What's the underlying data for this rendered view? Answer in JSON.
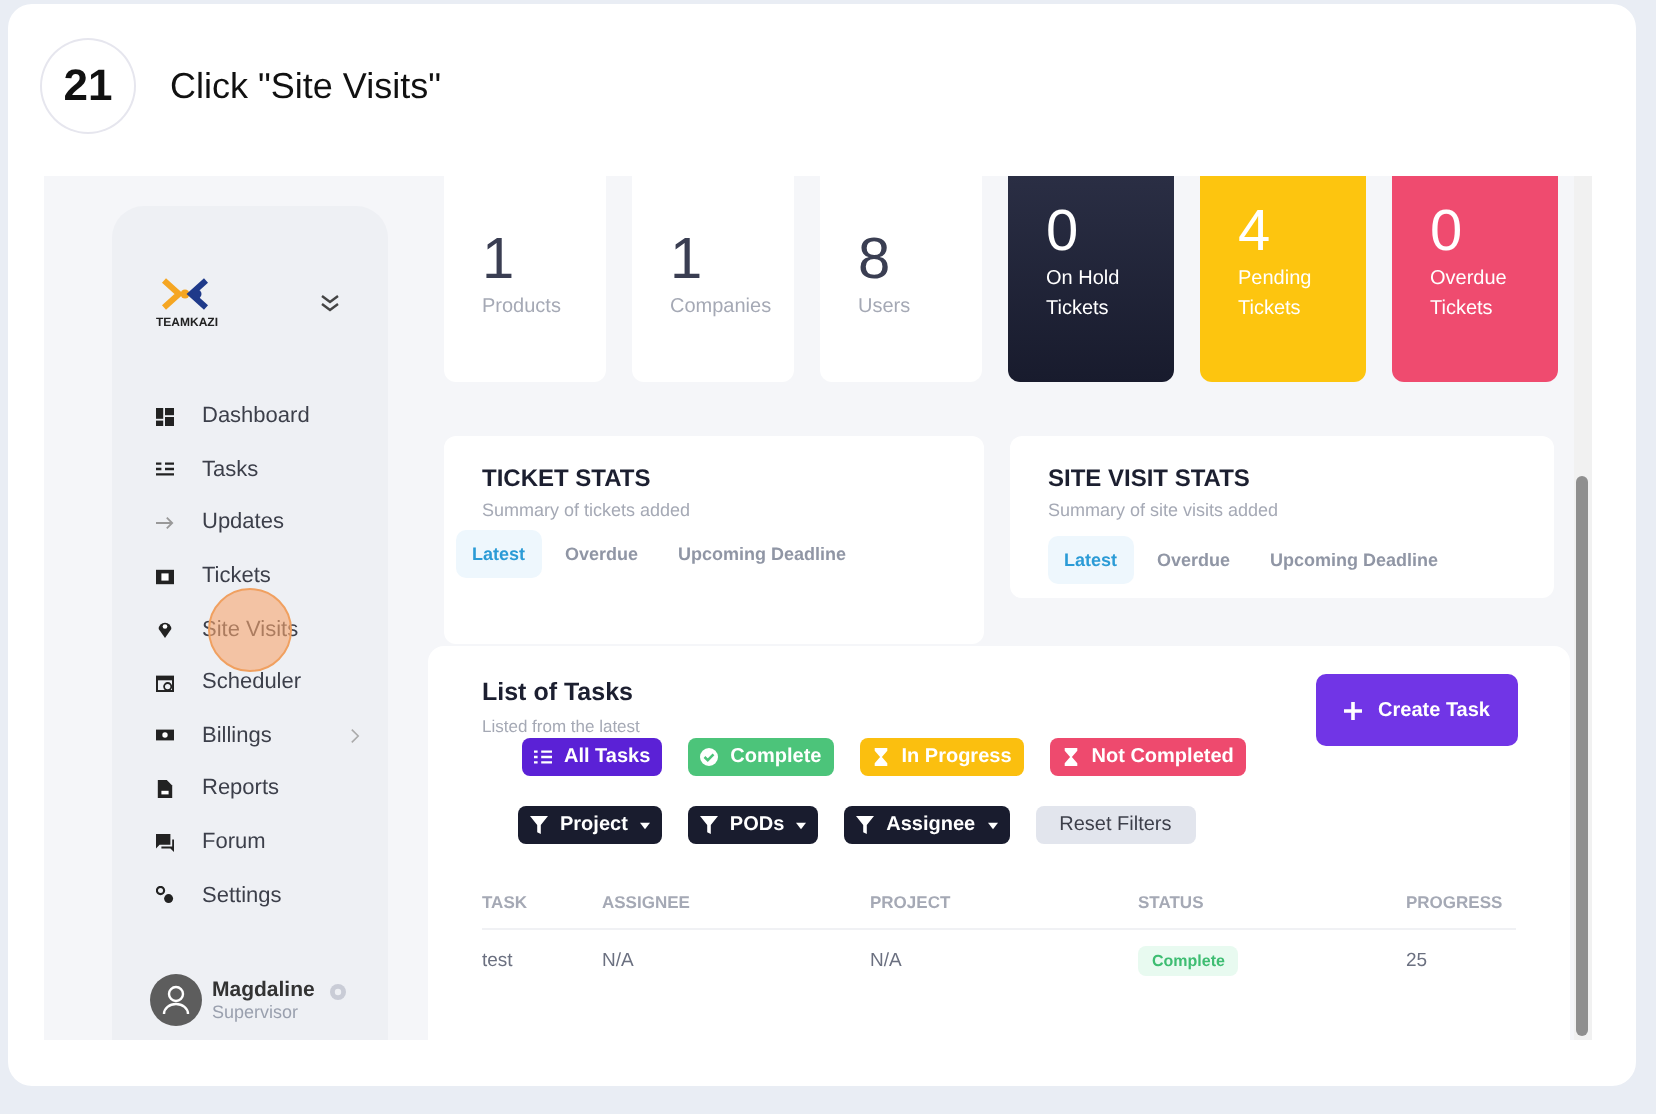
{
  "step": {
    "number": "21",
    "instruction": "Click \"Site Visits\""
  },
  "sidebar": {
    "items": [
      {
        "label": "Dashboard",
        "clicked": false,
        "submenu": false
      },
      {
        "label": "Tasks",
        "clicked": false,
        "submenu": false
      },
      {
        "label": "Updates",
        "clicked": false,
        "submenu": false
      },
      {
        "label": "Tickets",
        "clicked": false,
        "submenu": false
      },
      {
        "label": "Site Visits",
        "clicked": true,
        "submenu": false
      },
      {
        "label": "Scheduler",
        "clicked": false,
        "submenu": false
      },
      {
        "label": "Billings",
        "clicked": false,
        "submenu": true
      },
      {
        "label": "Reports",
        "clicked": false,
        "submenu": false
      },
      {
        "label": "Forum",
        "clicked": false,
        "submenu": false
      },
      {
        "label": "Settings",
        "clicked": false,
        "submenu": false
      }
    ],
    "logo_text": "TEAMKAZI",
    "user": {
      "name": "Magdaline",
      "role": "Supervisor"
    }
  },
  "stat_cards": [
    {
      "value": "1",
      "label": "Products",
      "kind": "plain"
    },
    {
      "value": "1",
      "label": "Companies",
      "kind": "plain"
    },
    {
      "value": "8",
      "label": "Users",
      "kind": "plain"
    },
    {
      "value": "0",
      "label": "On Hold Tickets",
      "kind": "dark"
    },
    {
      "value": "4",
      "label": "Pending Tickets",
      "kind": "yellow"
    },
    {
      "value": "0",
      "label": "Overdue Tickets",
      "kind": "red"
    }
  ],
  "panels": [
    {
      "title": "TICKET STATS",
      "subtitle": "Summary of tickets added",
      "tabs": [
        {
          "label": "Latest",
          "selected": true
        },
        {
          "label": "Overdue",
          "selected": false
        },
        {
          "label": "Upcoming Deadline",
          "selected": false
        }
      ]
    },
    {
      "title": "SITE VISIT STATS",
      "subtitle": "Summary of site visits added",
      "tabs": [
        {
          "label": "Latest",
          "selected": true
        },
        {
          "label": "Overdue",
          "selected": false
        },
        {
          "label": "Upcoming Deadline",
          "selected": false
        }
      ]
    }
  ],
  "tasks": {
    "title": "List of Tasks",
    "subtitle": "Listed from the latest",
    "create_button": "Create Task",
    "status_filters": [
      {
        "label": "All Tasks",
        "color": "#5b21d6",
        "kind": "all"
      },
      {
        "label": "Complete",
        "color": "#4cc47a",
        "kind": "complete"
      },
      {
        "label": "In Progress",
        "color": "#fbbf0f",
        "kind": "pending"
      },
      {
        "label": "Not Completed",
        "color": "#ee4a6e",
        "kind": "pending"
      }
    ],
    "dropdown_filters": [
      "Project",
      "PODs",
      "Assignee"
    ],
    "reset_button": "Reset Filters",
    "columns": [
      "TASK",
      "ASSIGNEE",
      "PROJECT",
      "STATUS",
      "PROGRESS"
    ],
    "rows": [
      {
        "task": "test",
        "assignee": "N/A",
        "project": "N/A",
        "status": "Complete",
        "progress": "25"
      }
    ]
  }
}
